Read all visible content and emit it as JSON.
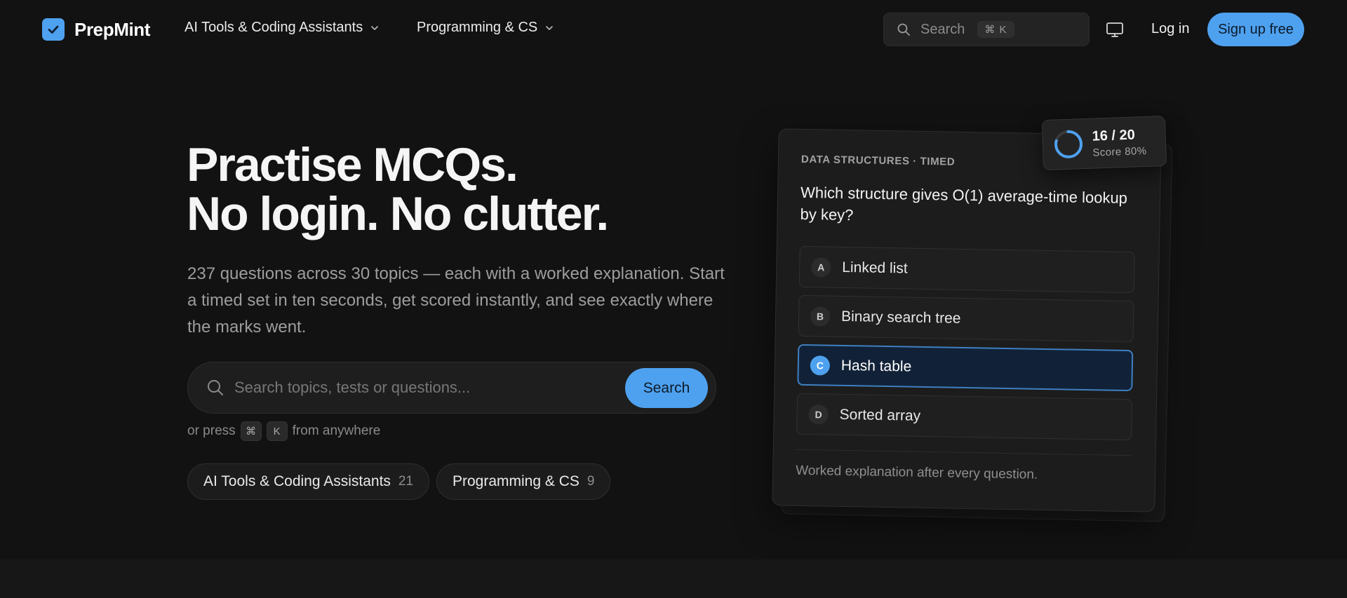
{
  "brand": {
    "name": "PrepMint",
    "accent": "#4ea1ef"
  },
  "nav": {
    "items": [
      {
        "label": "AI Tools & Coding Assistants",
        "icon": "chevron-down-icon"
      },
      {
        "label": "Programming & CS",
        "icon": "chevron-down-icon"
      }
    ]
  },
  "header": {
    "search_placeholder": "Search",
    "search_shortcut": "⌘ K",
    "display_icon": "monitor-icon",
    "login_label": "Log in",
    "signup_label": "Sign up free"
  },
  "hero": {
    "title_line1": "Practise MCQs.",
    "title_line2": "No login. No clutter.",
    "subtitle": "237 questions across 30 topics — each with a worked explanation. Start a timed set in ten seconds, get scored instantly, and see exactly where the marks went.",
    "search_placeholder": "Search topics, tests or questions...",
    "search_button": "Search",
    "press_prefix": "or press",
    "press_key1": "⌘",
    "press_key2": "K",
    "press_suffix": "from anywhere",
    "chips": [
      {
        "label": "AI Tools & Coding Assistants",
        "count": "21"
      },
      {
        "label": "Programming & CS",
        "count": "9"
      }
    ]
  },
  "preview": {
    "meta": "DATA STRUCTURES · TIMED",
    "question": "Which structure gives O(1) average-time lookup by key?",
    "options": [
      {
        "letter": "A",
        "text": "Linked list"
      },
      {
        "letter": "B",
        "text": "Binary search tree"
      },
      {
        "letter": "C",
        "text": "Hash table"
      },
      {
        "letter": "D",
        "text": "Sorted array"
      }
    ],
    "selected": "C",
    "footer": "Worked explanation after every question.",
    "score": {
      "main": "16 / 20",
      "sub": "Score 80%",
      "fraction": 0.8
    }
  }
}
